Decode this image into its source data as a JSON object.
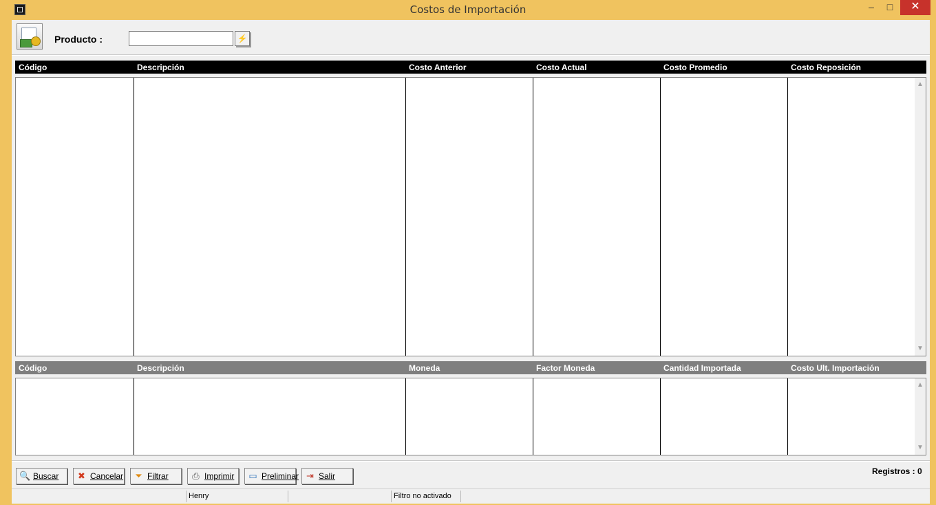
{
  "window": {
    "title": "Costos de Importación",
    "minimize_glyph": "–",
    "maximize_glyph": "□",
    "close_glyph": "✕"
  },
  "header": {
    "producto_label": "Producto :",
    "producto_value": "",
    "search_glyph": "⚡",
    "icon": "inventory-money-icon"
  },
  "grid_top": {
    "columns": [
      "Código",
      "Descripción",
      "Costo Anterior",
      "Costo Actual",
      "Costo Promedio",
      "Costo Reposición"
    ],
    "rows": []
  },
  "grid_bottom": {
    "columns": [
      "Código",
      "Descripción",
      "Moneda",
      "Factor Moneda",
      "Cantidad Importada",
      "Costo Ult. Importación"
    ],
    "rows": []
  },
  "scroll": {
    "up_glyph": "▲",
    "down_glyph": "▼"
  },
  "toolbar": {
    "buttons": [
      {
        "label": "Buscar",
        "icon": "magnifier-icon",
        "glyph": "🔍"
      },
      {
        "label": "Cancelar",
        "icon": "cancel-x-icon",
        "glyph": "✖"
      },
      {
        "label": "Filtrar",
        "icon": "filter-funnel-icon",
        "glyph": "⏷"
      },
      {
        "label": "Imprimir",
        "icon": "printer-icon",
        "glyph": "⎙"
      },
      {
        "label": "Preliminar",
        "icon": "monitor-preview-icon",
        "glyph": "▭"
      },
      {
        "label": "Salir",
        "icon": "exit-door-icon",
        "glyph": "⇥"
      }
    ],
    "registros": "Registros : 0"
  },
  "statusbar": {
    "panels": [
      "",
      "Henry",
      "",
      "Filtro no activado",
      ""
    ]
  },
  "colors": {
    "frame": "#f0c35f",
    "top_header": "#000000",
    "bottom_header": "#7f7f7f",
    "close": "#c7322b"
  }
}
